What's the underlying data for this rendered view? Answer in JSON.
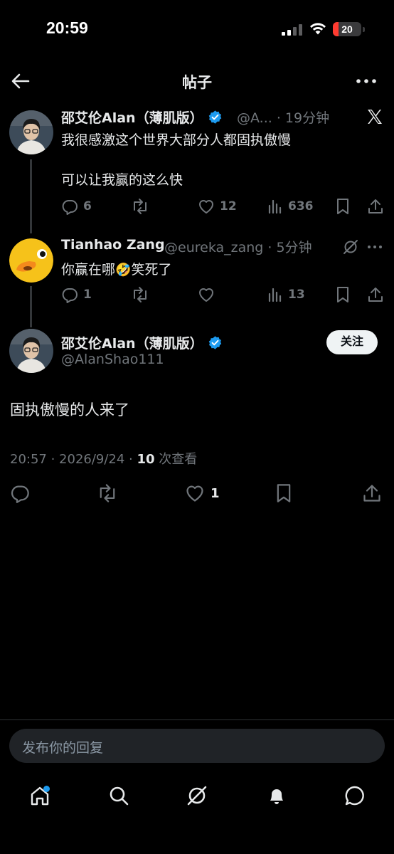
{
  "status_bar": {
    "time": "20:59",
    "battery": "20",
    "battery_level": 0.2
  },
  "header": {
    "title": "帖子"
  },
  "colors": {
    "verified": "#1d9bf0",
    "battery_low": "#ff3b30",
    "accent": "#1d9bf0"
  },
  "post1": {
    "name": "邵艾伦Alan（薄肌版）",
    "meta": "@A... · 19分钟",
    "line1": "我很感激这个世界大部分人都固执傲慢",
    "line2": "可以让我赢的这么快",
    "replies": "6",
    "likes": "12",
    "views": "636"
  },
  "post2": {
    "name": "Tianhao Zang",
    "meta": "@eureka_zang · 5分钟",
    "text_before": "你赢在哪",
    "emoji": "🤣",
    "text_after": "笑死了",
    "replies": "1",
    "views": "13"
  },
  "post3": {
    "name": "邵艾伦Alan（薄肌版）",
    "handle": "@AlanShao111",
    "follow_label": "关注",
    "text": "固执傲慢的人来了",
    "timestamp": "20:57 · 2026/9/24 · ",
    "views_count": "10",
    "views_label": " 次查看",
    "likes": "1"
  },
  "reply": {
    "placeholder": "发布你的回复"
  },
  "icons": [
    "back-arrow-icon",
    "more-icon",
    "x-logo-icon",
    "verified-badge-icon",
    "reply-icon",
    "retweet-icon",
    "like-icon",
    "views-icon",
    "bookmark-icon",
    "share-icon",
    "grok-icon",
    "home-icon",
    "search-icon",
    "bell-icon",
    "messages-icon"
  ]
}
